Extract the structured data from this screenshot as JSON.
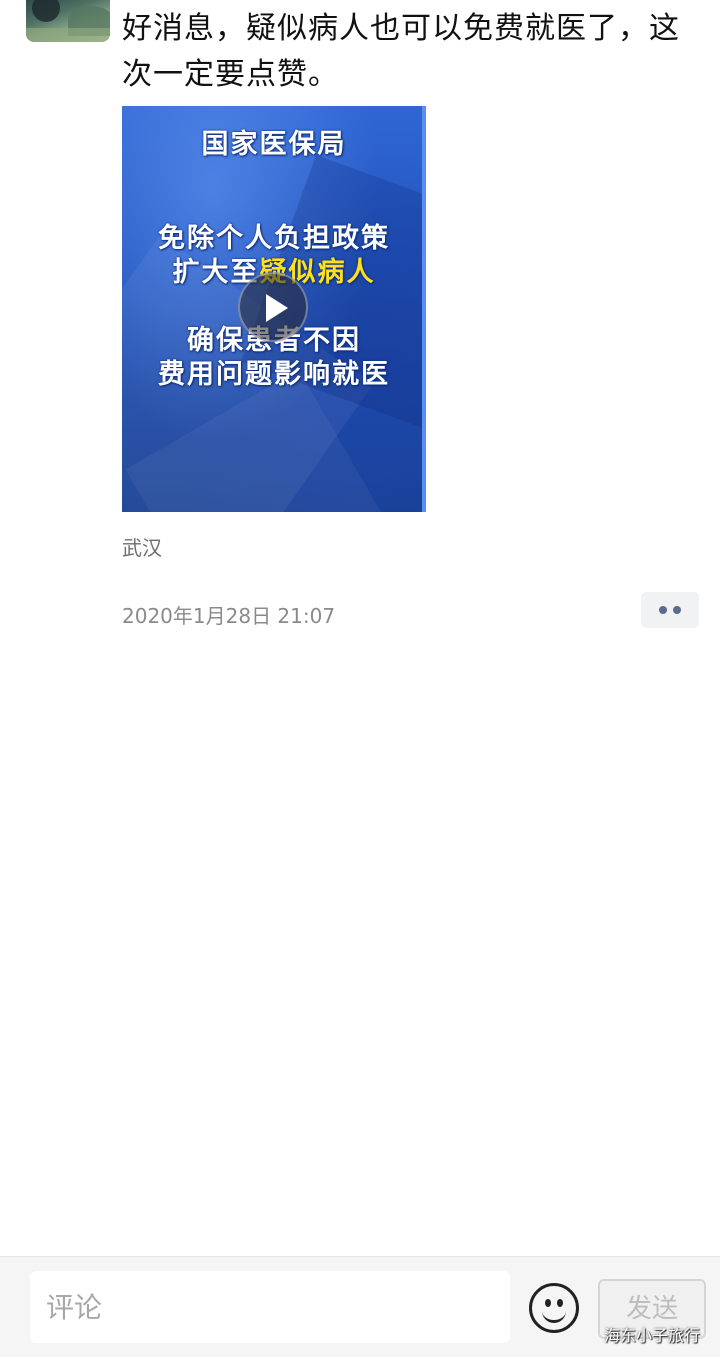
{
  "post": {
    "text": "好消息，疑似病人也可以免费就医了，这次一定要点赞。",
    "location": "武汉",
    "timestamp": "2020年1月28日 21:07"
  },
  "video": {
    "line1": "国家医保局",
    "line2": "免除个人负担政策",
    "line3_prefix": "扩大至",
    "line3_highlight": "疑似病人",
    "line4": "确保患者不因",
    "line5": "费用问题影响就医",
    "highlight_color": "#ffe01a",
    "background_color": "#2457c2"
  },
  "icons": {
    "play": "play-icon",
    "more": "more-dots-icon",
    "emoji": "smiley-icon"
  },
  "comment_bar": {
    "placeholder": "评论",
    "send_label": "发送"
  },
  "watermark": "海东小子旅行"
}
